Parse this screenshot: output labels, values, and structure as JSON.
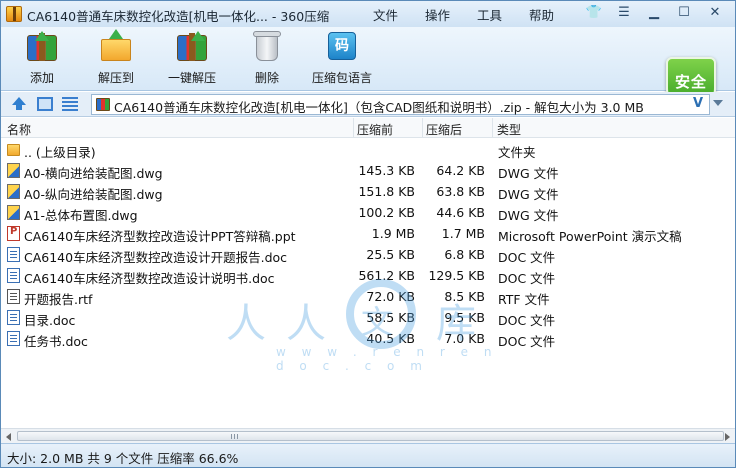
{
  "window": {
    "title": "CA6140普通车床数控化改造[机电一体化... - 360压缩",
    "menus": [
      "文件",
      "操作",
      "工具",
      "帮助"
    ]
  },
  "toolbar": {
    "buttons": [
      {
        "label": "添加",
        "icon": "add-archive-icon"
      },
      {
        "label": "解压到",
        "icon": "extract-to-icon"
      },
      {
        "label": "一键解压",
        "icon": "one-click-extract-icon"
      },
      {
        "label": "删除",
        "icon": "trash-icon"
      },
      {
        "label": "压缩包语言",
        "icon": "archive-language-icon"
      }
    ],
    "code_glyph": "码",
    "security_label": "安全"
  },
  "address": {
    "path": "CA6140普通车床数控化改造[机电一体化]（包含CAD图纸和说明书）.zip - 解包大小为 3.0 MB",
    "v_glyph": "V"
  },
  "columns": {
    "name": "名称",
    "compressed": "压缩前",
    "packed": "压缩后",
    "type": "类型"
  },
  "files": [
    {
      "name": ".. (上级目录)",
      "before": "",
      "after": "",
      "type": "文件夹",
      "icon": "folder"
    },
    {
      "name": "A0-横向进给装配图.dwg",
      "before": "145.3 KB",
      "after": "64.2 KB",
      "type": "DWG 文件",
      "icon": "dwg"
    },
    {
      "name": "A0-纵向进给装配图.dwg",
      "before": "151.8 KB",
      "after": "63.8 KB",
      "type": "DWG 文件",
      "icon": "dwg"
    },
    {
      "name": "A1-总体布置图.dwg",
      "before": "100.2 KB",
      "after": "44.6 KB",
      "type": "DWG 文件",
      "icon": "dwg"
    },
    {
      "name": "CA6140车床经济型数控改造设计PPT答辩稿.ppt",
      "before": "1.9 MB",
      "after": "1.7 MB",
      "type": "Microsoft PowerPoint 演示文稿",
      "icon": "ppt"
    },
    {
      "name": "CA6140车床经济型数控改造设计开题报告.doc",
      "before": "25.5 KB",
      "after": "6.8 KB",
      "type": "DOC 文件",
      "icon": "doc"
    },
    {
      "name": "CA6140车床经济型数控改造设计说明书.doc",
      "before": "561.2 KB",
      "after": "129.5 KB",
      "type": "DOC 文件",
      "icon": "doc"
    },
    {
      "name": "开题报告.rtf",
      "before": "72.0 KB",
      "after": "8.5 KB",
      "type": "RTF 文件",
      "icon": "rtf"
    },
    {
      "name": "目录.doc",
      "before": "58.5 KB",
      "after": "9.5 KB",
      "type": "DOC 文件",
      "icon": "doc"
    },
    {
      "name": "任务书.doc",
      "before": "40.5 KB",
      "after": "7.0 KB",
      "type": "DOC 文件",
      "icon": "doc"
    }
  ],
  "watermark": {
    "chars": [
      "人",
      "人",
      "文",
      "库"
    ],
    "url": "w w w . r e n r e n d o c . c o m"
  },
  "status": {
    "text": "大小: 2.0 MB 共 9 个文件 压缩率 66.6%"
  }
}
